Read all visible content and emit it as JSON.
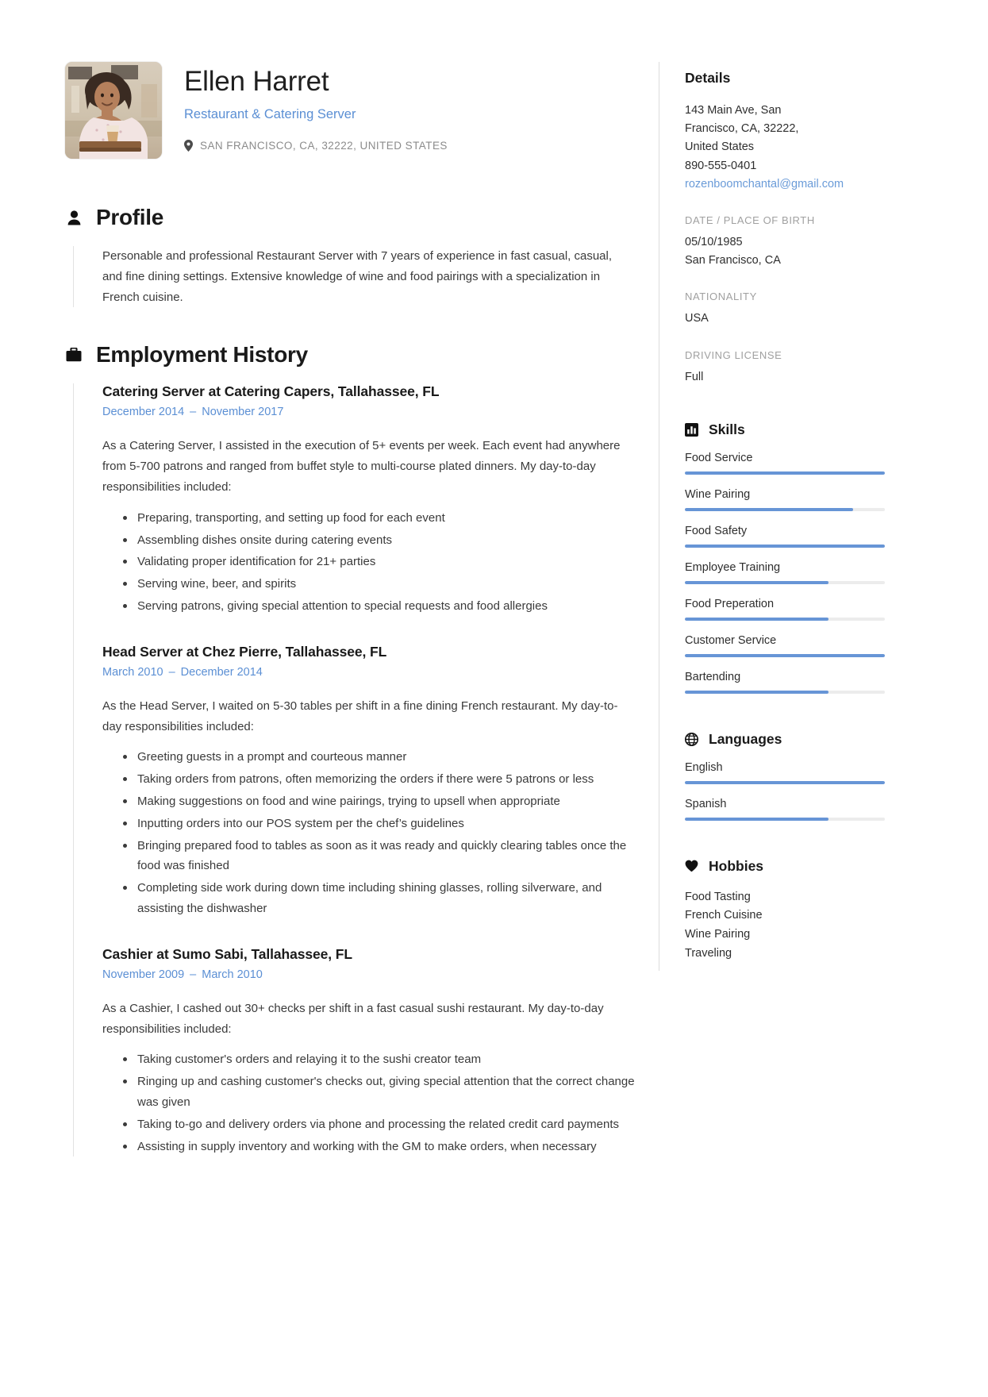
{
  "person": {
    "full_name": "Ellen Harret",
    "job_title": "Restaurant & Catering Server",
    "location": "SAN FRANCISCO, CA, 32222, UNITED STATES"
  },
  "profile": {
    "heading": "Profile",
    "icon": "person-icon",
    "text": "Personable and professional Restaurant Server with 7 years of experience in fast casual, casual, and fine dining settings. Extensive knowledge of wine and food pairings with a specialization in French cuisine."
  },
  "employment": {
    "heading": "Employment History",
    "icon": "briefcase-icon",
    "jobs": [
      {
        "role": "Catering Server at Catering Capers, Tallahassee, FL",
        "start": "December 2014",
        "dash": "–",
        "end": "November 2017",
        "description": "As a Catering Server, I assisted in the execution of 5+ events per week. Each event had anywhere from 5-700 patrons and ranged from buffet style to multi-course plated dinners. My day-to-day responsibilities included:",
        "bullets": [
          "Preparing, transporting, and setting up food for each event",
          "Assembling dishes onsite during catering events",
          "Validating proper identification for 21+ parties",
          "Serving wine, beer, and spirits",
          "Serving patrons, giving special attention to special requests and food allergies"
        ]
      },
      {
        "role": "Head Server at Chez Pierre, Tallahassee, FL",
        "start": "March 2010",
        "dash": "–",
        "end": "December 2014",
        "description": "As the Head Server, I waited on 5-30 tables per shift in a fine dining French restaurant. My day-to-day responsibilities included:",
        "bullets": [
          "Greeting guests in a prompt and courteous manner",
          "Taking orders from patrons, often memorizing the orders if there were 5 patrons or less",
          "Making suggestions on food and wine pairings, trying to upsell when appropriate",
          "Inputting orders into our POS system per the chef’s guidelines",
          "Bringing prepared food to tables as soon as it was ready and quickly clearing tables once the food was finished",
          "Completing side work during down time including shining glasses, rolling silverware, and assisting the dishwasher"
        ]
      },
      {
        "role": "Cashier at Sumo Sabi, Tallahassee, FL",
        "start": "November 2009",
        "dash": "–",
        "end": "March 2010",
        "description": "As a Cashier, I cashed out 30+ checks per shift in a fast casual sushi restaurant. My day-to-day responsibilities included:",
        "bullets": [
          "Taking customer's orders and relaying it to the sushi creator team",
          "Ringing up and cashing customer's checks out, giving special attention that the correct change was given",
          "Taking to-go and delivery orders via phone and processing the related credit card payments",
          "Assisting in supply inventory and working with the GM to make orders, when necessary"
        ]
      }
    ]
  },
  "details": {
    "heading": "Details",
    "address_lines": [
      "143 Main Ave, San",
      "Francisco, CA, 32222,",
      "United States"
    ],
    "phone": "890-555-0401",
    "email": "rozenboomchantal@gmail.com",
    "dob_label": "DATE / PLACE OF BIRTH",
    "dob_date": "05/10/1985",
    "dob_place": "San Francisco, CA",
    "nationality_label": "NATIONALITY",
    "nationality_value": "USA",
    "license_label": "DRIVING LICENSE",
    "license_value": "Full"
  },
  "skills": {
    "heading": "Skills",
    "icon": "bar-chart-icon",
    "items": [
      {
        "name": "Food Service",
        "level": 100
      },
      {
        "name": "Wine Pairing",
        "level": 84
      },
      {
        "name": "Food Safety",
        "level": 100
      },
      {
        "name": "Employee Training",
        "level": 72
      },
      {
        "name": "Food Preperation",
        "level": 72
      },
      {
        "name": "Customer Service",
        "level": 100
      },
      {
        "name": "Bartending",
        "level": 72
      }
    ]
  },
  "languages": {
    "heading": "Languages",
    "icon": "globe-icon",
    "items": [
      {
        "name": "English",
        "level": 100
      },
      {
        "name": "Spanish",
        "level": 72
      }
    ]
  },
  "hobbies": {
    "heading": "Hobbies",
    "icon": "heart-icon",
    "items": [
      "Food Tasting",
      "French Cuisine",
      "Wine Pairing",
      "Traveling"
    ]
  },
  "colors": {
    "accent": "#5b8fd4",
    "bar_fill": "#6795d6",
    "bar_track": "#ececec",
    "text": "#3a3a3a",
    "muted": "#a0a0a0"
  }
}
